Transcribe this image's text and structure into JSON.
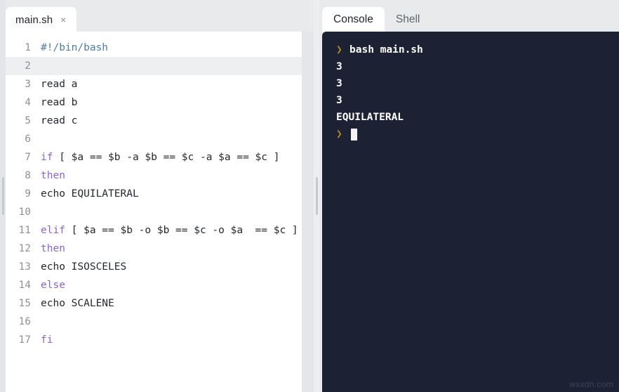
{
  "editor": {
    "tabs": [
      {
        "label": "main.sh",
        "close_icon": "×",
        "active": true
      }
    ],
    "lines": [
      {
        "no": "1",
        "text": "#!/bin/bash",
        "style": "shebang",
        "active": false
      },
      {
        "no": "2",
        "text": "",
        "style": "plain",
        "active": true
      },
      {
        "no": "3",
        "text": "read a",
        "style": "plain",
        "active": false
      },
      {
        "no": "4",
        "text": "read b",
        "style": "plain",
        "active": false
      },
      {
        "no": "5",
        "text": "read c",
        "style": "plain",
        "active": false
      },
      {
        "no": "6",
        "text": "",
        "style": "plain",
        "active": false
      },
      {
        "no": "7",
        "keyword": "if",
        "text": " [ $a == $b -a $b == $c -a $a == $c ]",
        "style": "keyword",
        "active": false
      },
      {
        "no": "8",
        "keyword": "then",
        "text": "",
        "style": "keyword",
        "active": false
      },
      {
        "no": "9",
        "text": "echo EQUILATERAL",
        "style": "plain",
        "active": false
      },
      {
        "no": "10",
        "text": "",
        "style": "plain",
        "active": false
      },
      {
        "no": "11",
        "keyword": "elif",
        "text": " [ $a == $b -o $b == $c -o $a  == $c ]",
        "style": "keyword",
        "active": false
      },
      {
        "no": "12",
        "keyword": "then",
        "text": "",
        "style": "keyword",
        "active": false
      },
      {
        "no": "13",
        "text": "echo ISOSCELES",
        "style": "plain",
        "active": false
      },
      {
        "no": "14",
        "keyword": "else",
        "text": "",
        "style": "keyword",
        "active": false
      },
      {
        "no": "15",
        "text": "echo SCALENE",
        "style": "plain",
        "active": false
      },
      {
        "no": "16",
        "text": "",
        "style": "plain",
        "active": false
      },
      {
        "no": "17",
        "keyword": "fi",
        "text": "",
        "style": "keyword",
        "active": false
      }
    ]
  },
  "console": {
    "tabs": [
      {
        "label": "Console",
        "active": true
      },
      {
        "label": "Shell",
        "active": false
      }
    ],
    "prompt_symbol": "❯",
    "lines": [
      {
        "prompt": true,
        "text": "bash main.sh",
        "cursor": false
      },
      {
        "prompt": false,
        "text": "3",
        "cursor": false
      },
      {
        "prompt": false,
        "text": "3",
        "cursor": false
      },
      {
        "prompt": false,
        "text": "3",
        "cursor": false
      },
      {
        "prompt": false,
        "text": "EQUILATERAL",
        "cursor": false
      },
      {
        "prompt": true,
        "text": "",
        "cursor": true
      }
    ]
  },
  "watermark": {
    "text": "wsxdn.com"
  },
  "colors": {
    "app_background": "#e9eaec",
    "editor_background": "#ffffff",
    "console_background": "#1c2233",
    "keyword": "#8a63d2",
    "shebang": "#4d7ea8",
    "code_text": "#24292e",
    "line_number": "#8d9299",
    "prompt": "#b5851f",
    "console_text": "#ffffff",
    "active_line": "#eeeff1"
  }
}
